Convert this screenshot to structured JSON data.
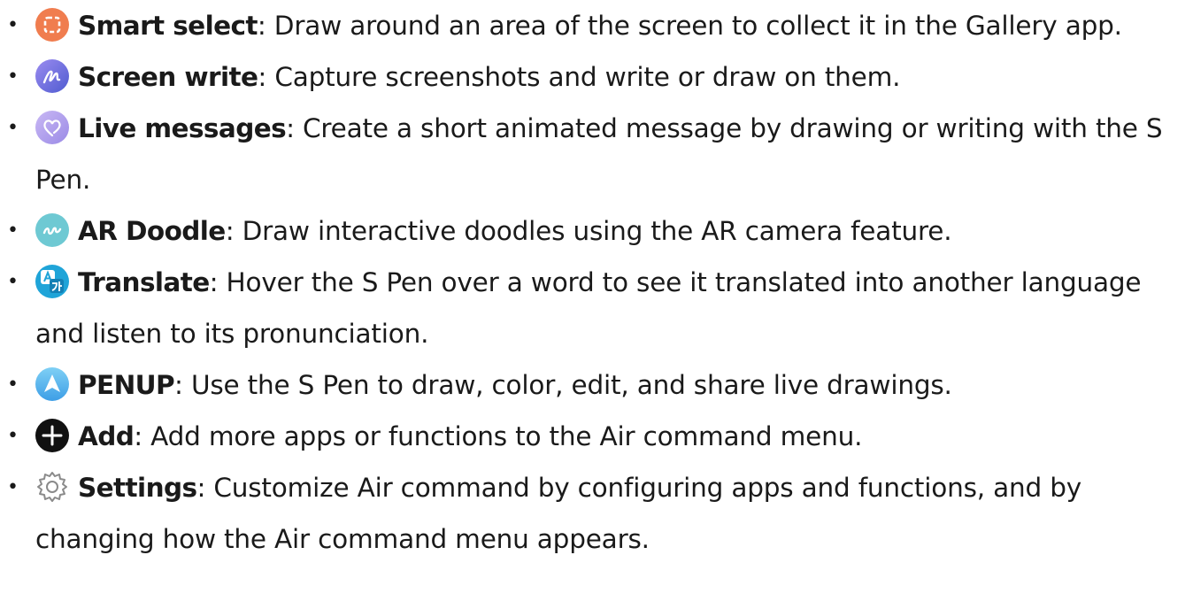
{
  "items": [
    {
      "term": "Smart select",
      "desc": ": Draw around an area of the screen to collect it in the Gallery app.",
      "icon": "smart-select-icon",
      "icon_color": "#f07d4f"
    },
    {
      "term": "Screen write",
      "desc": ": Capture screenshots and write or draw on them.",
      "icon": "screen-write-icon",
      "icon_color": "#6e6bd8"
    },
    {
      "term": "Live messages",
      "desc": ": Create a short animated message by drawing or writing with the S Pen.",
      "icon": "live-messages-icon",
      "icon_color": "#b7a9ee"
    },
    {
      "term": "AR Doodle",
      "desc": ": Draw interactive doodles using the AR camera feature.",
      "icon": "ar-doodle-icon",
      "icon_color": "#6ec9d3"
    },
    {
      "term": "Translate",
      "desc": ": Hover the S Pen over a word to see it translated into another language and listen to its pronunciation.",
      "icon": "translate-icon",
      "icon_color": "#1fa4d8"
    },
    {
      "term": "PENUP",
      "desc": ": Use the S Pen to draw, color, edit, and share live drawings.",
      "icon": "penup-icon",
      "icon_color": "#58b8ee"
    },
    {
      "term": "Add",
      "desc": ": Add more apps or functions to the Air command menu.",
      "icon": "add-icon",
      "icon_color": "#111111"
    },
    {
      "term": "Settings",
      "desc": ": Customize Air command by configuring apps and functions, and by changing how the Air command menu appears.",
      "icon": "settings-icon",
      "icon_color": "#8a8a8a"
    }
  ]
}
